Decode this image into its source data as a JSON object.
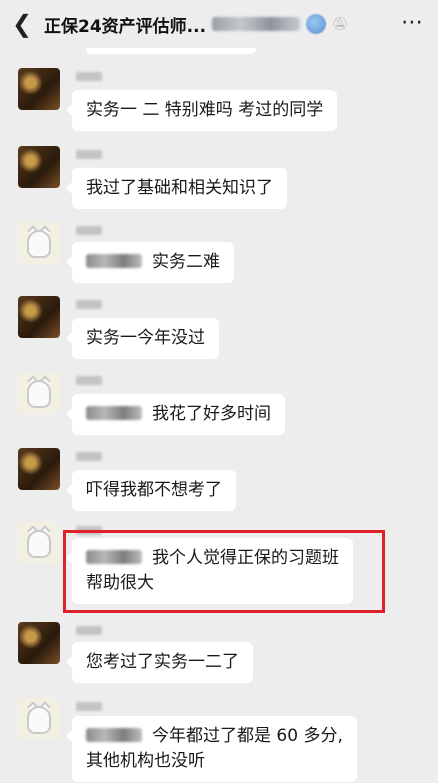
{
  "header": {
    "back_icon": "chevron-left-icon",
    "title": "正保24资产评估师...",
    "more_icon": "more-dots-icon"
  },
  "messages": [
    {
      "avatar": "dark",
      "text": "实务一 二 特别难吗 考过的同学"
    },
    {
      "avatar": "dark",
      "text": "我过了基础和相关知识了"
    },
    {
      "avatar": "light",
      "mention": true,
      "text": "实务二难"
    },
    {
      "avatar": "dark",
      "text": "实务一今年没过"
    },
    {
      "avatar": "light",
      "mention": true,
      "text": "我花了好多时间"
    },
    {
      "avatar": "dark",
      "text": "吓得我都不想考了"
    },
    {
      "avatar": "light",
      "mention": true,
      "line1": "我个人觉得正保的习题班",
      "line2": "帮助很大",
      "highlighted": true
    },
    {
      "avatar": "dark",
      "text": "您考过了实务一二了"
    },
    {
      "avatar": "light",
      "mention": true,
      "line1": "今年都过了都是 60 多分,",
      "line2": "其他机构也没听"
    }
  ],
  "colors": {
    "background": "#ededed",
    "bubble": "#ffffff",
    "highlight": "#e0202a"
  }
}
